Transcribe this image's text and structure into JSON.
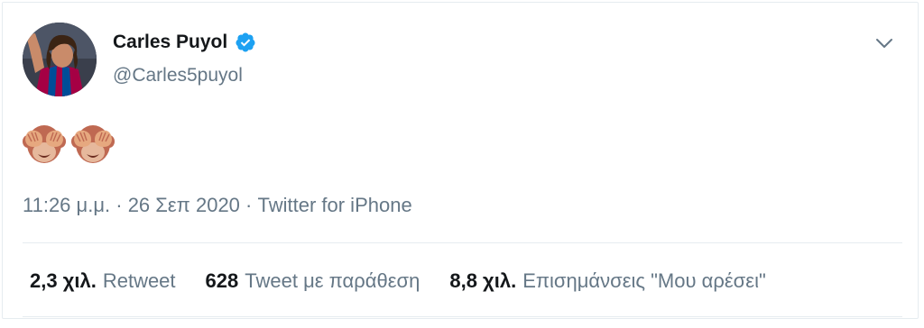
{
  "tweet": {
    "author_name": "Carles Puyol",
    "author_handle": "@Carles5puyol",
    "emoji_icons": [
      "see-no-evil-monkey-icon",
      "see-no-evil-monkey-icon"
    ],
    "time": "11:26 μ.μ.",
    "separator": "·",
    "date": "26 Σεπ 2020",
    "source": "Twitter for iPhone"
  },
  "stats": {
    "retweets_count": "2,3 χιλ.",
    "retweets_label": "Retweet",
    "quotes_count": "628",
    "quotes_label": "Tweet με παράθεση",
    "likes_count": "8,8 χιλ.",
    "likes_label": "Επισημάνσεις \"Μου αρέσει\""
  },
  "colors": {
    "verified": "#1da1f2",
    "secondary_text": "#657786",
    "primary_text": "#14171a",
    "divider": "#e6ecf0"
  }
}
